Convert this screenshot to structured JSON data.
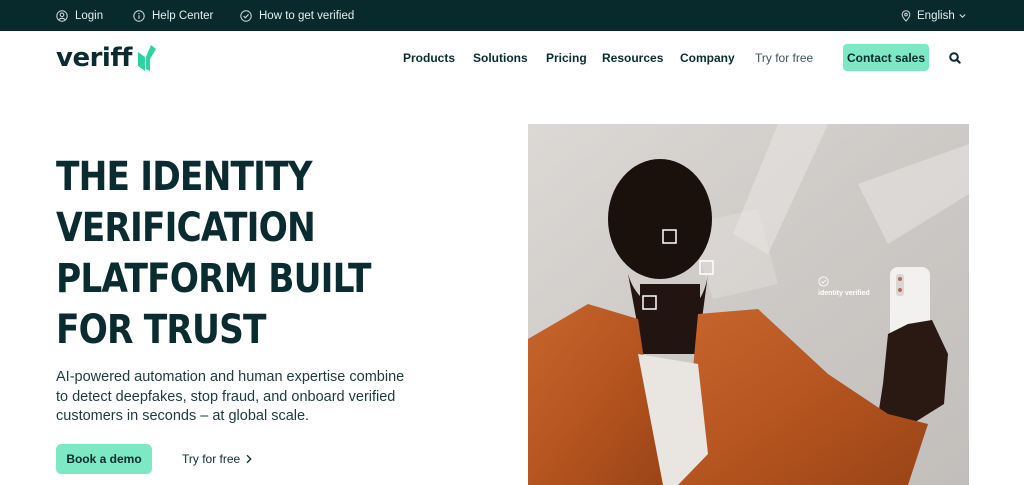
{
  "topbar": {
    "login": "Login",
    "help_center": "Help Center",
    "get_verified": "How to get verified",
    "language": "English"
  },
  "nav": {
    "logo": "veriff",
    "items": [
      "Products",
      "Solutions",
      "Pricing",
      "Resources",
      "Company"
    ],
    "try_free": "Try for free",
    "contact_sales": "Contact sales"
  },
  "hero": {
    "title_lines": [
      "THE IDENTITY",
      "VERIFICATION",
      "PLATFORM BUILT",
      "FOR TRUST"
    ],
    "subtitle": "AI-powered automation and human expertise combine to detect deepfakes, stop fraud, and onboard verified customers in seconds – at global scale.",
    "book_demo": "Book a demo",
    "try_free": "Try for free",
    "image_badge": "identity verified"
  },
  "colors": {
    "topbar_bg": "#082a2d",
    "brand_dark": "#0a2c30",
    "accent_mint": "#7ce8c4",
    "logo_mark": "#2fd39f"
  },
  "icons": {
    "login": "user-circle-icon",
    "help": "info-circle-icon",
    "verified": "check-circle-icon",
    "language": "location-pin-icon",
    "search": "search-icon"
  }
}
